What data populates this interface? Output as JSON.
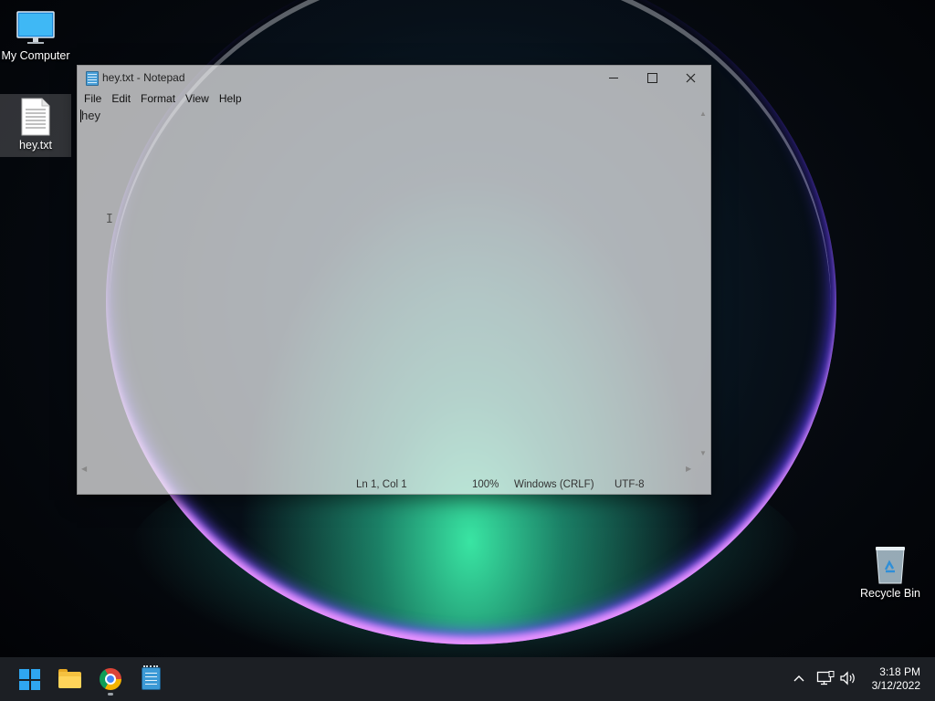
{
  "desktop": {
    "icons": [
      {
        "label": "My Computer"
      },
      {
        "label": "hey.txt"
      },
      {
        "label": "Recycle Bin"
      }
    ]
  },
  "notepad": {
    "title": "hey.txt - Notepad",
    "menu": [
      "File",
      "Edit",
      "Format",
      "View",
      "Help"
    ],
    "content": "hey",
    "status": {
      "position": "Ln 1, Col 1",
      "zoom": "100%",
      "line_ending": "Windows (CRLF)",
      "encoding": "UTF-8"
    }
  },
  "taskbar": {
    "apps": [
      "start-button",
      "file-explorer",
      "chrome",
      "notepad"
    ],
    "time": "3:18 PM",
    "date": "3/12/2022"
  },
  "colors": {
    "taskbar_bg": "#1c1f24",
    "windows_blue": "#2fa6f0"
  }
}
